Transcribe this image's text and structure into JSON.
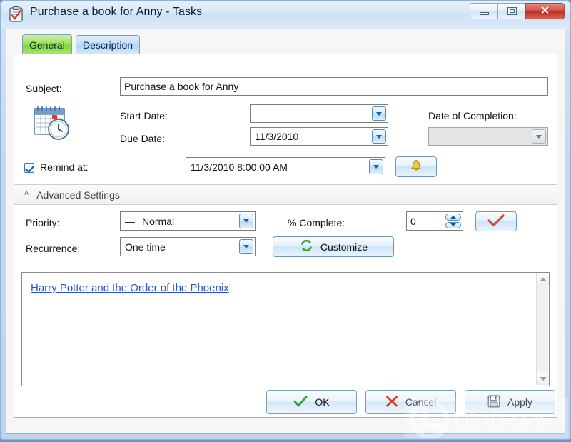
{
  "window": {
    "title": "Purchase a book for Anny  - Tasks",
    "app_icon": "clipboard-check-icon",
    "controls": {
      "minimize": "Minimize",
      "maximize": "Maximize",
      "close": "Close"
    }
  },
  "tabs": [
    {
      "id": "general",
      "label": "General",
      "active": true,
      "color": "#7fd639"
    },
    {
      "id": "description",
      "label": "Description",
      "active": false,
      "color": "#aed5f5"
    }
  ],
  "form": {
    "task_icon": "calendar-clock-icon",
    "subject": {
      "label": "Subject:",
      "value": "Purchase a book for Anny",
      "placeholder": ""
    },
    "start_date": {
      "label": "Start Date:",
      "value": "",
      "placeholder": ""
    },
    "due_date": {
      "label": "Due Date:",
      "value": "11/3/2010",
      "placeholder": ""
    },
    "date_of_completion": {
      "label": "Date of Completion:",
      "value": "",
      "placeholder": "",
      "disabled": true
    },
    "remind": {
      "label": "Remind at:",
      "checked": true,
      "value": "11/3/2010 8:00:00 AM",
      "bell_button": "bell-icon"
    },
    "advanced_settings": {
      "label": "Advanced Settings",
      "chevron": "chevron-up-icon",
      "expanded": true
    },
    "priority": {
      "label": "Priority:",
      "value": "Normal",
      "prefix_glyph": "—"
    },
    "recurrence": {
      "label": "Recurrence:",
      "value": "One time"
    },
    "percent_complete": {
      "label": "% Complete:",
      "value": "0"
    },
    "customize": {
      "label": "Customize",
      "icon": "recycle-arrows-icon"
    },
    "confirm_button": {
      "icon": "red-check-icon",
      "label": ""
    },
    "notes": {
      "link_text": "Harry Potter and the Order of the Phoenix",
      "link_color": "#2a4fd8"
    }
  },
  "footer": {
    "ok": {
      "label": "OK",
      "icon": "green-check-icon"
    },
    "cancel": {
      "label": "Cancel",
      "icon": "red-x-icon"
    },
    "apply": {
      "label": "Apply",
      "icon": "floppy-disk-icon"
    }
  },
  "watermark": {
    "text": "LO4D.com"
  }
}
